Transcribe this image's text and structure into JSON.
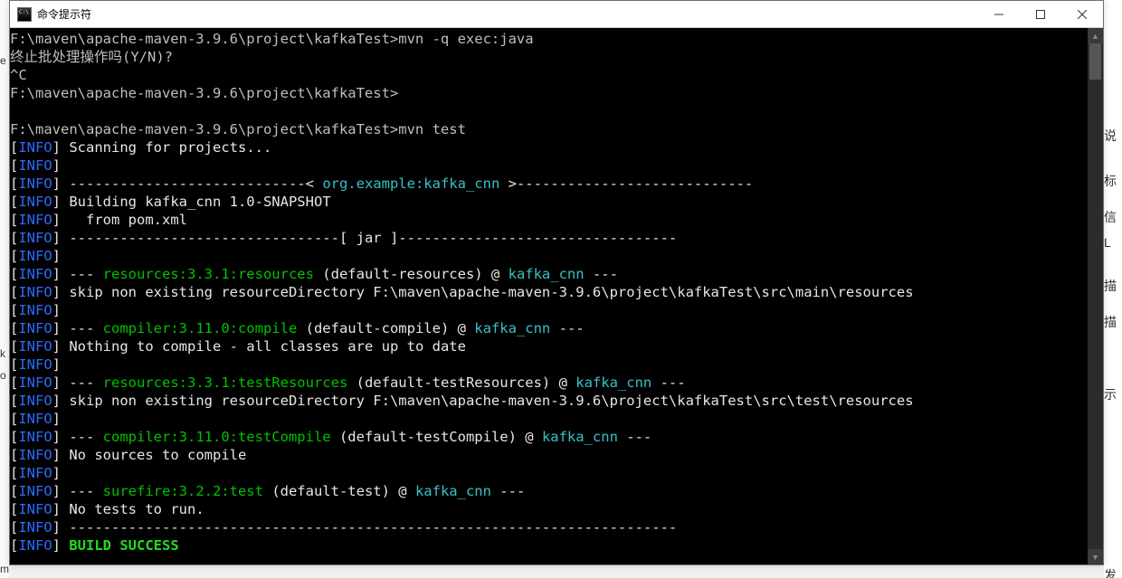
{
  "window": {
    "title": "命令提示符",
    "icon_name": "cmd-icon"
  },
  "prompt_path": "F:\\maven\\apache-maven-3.9.6\\project\\kafkaTest>",
  "lines": {
    "cmd1": "mvn -q exec:java",
    "l2": "终止批处理操作吗(Y/N)?",
    "l3": "^C",
    "cmd2_empty": "",
    "l_blank_path": "F:\\maven\\apache-maven-3.9.6\\project\\kafkaTest>",
    "cmd2": "mvn test",
    "scan": "Scanning for projects...",
    "rule1_pre": "----------------------------< ",
    "proj_id": "org.example:kafka_cnn",
    "rule1_post": " >----------------------------",
    "building": "Building kafka_cnn 1.0-SNAPSHOT",
    "from_pom": "  from pom.xml",
    "rule_jar": "--------------------------------[ jar ]---------------------------------",
    "goal_res": "resources:3.3.1:resources",
    "goal_res_rest_a": " (default-resources) @ ",
    "goal_res_rest_b": " ---",
    "skip_main": "skip non existing resourceDirectory F:\\maven\\apache-maven-3.9.6\\project\\kafkaTest\\src\\main\\resources",
    "goal_compile": "compiler:3.11.0:compile",
    "compile_rest_a": " (default-compile) @ ",
    "nothing_compile": "Nothing to compile - all classes are up to date",
    "goal_testres": "resources:3.3.1:testResources",
    "testres_rest_a": " (default-testResources) @ ",
    "skip_test": "skip non existing resourceDirectory F:\\maven\\apache-maven-3.9.6\\project\\kafkaTest\\src\\test\\resources",
    "goal_testcompile": "compiler:3.11.0:testCompile",
    "testcompile_rest_a": " (default-testCompile) @ ",
    "no_sources": "No sources to compile",
    "goal_surefire": "surefire:3.2.2:test",
    "surefire_rest_a": " (default-test) @ ",
    "no_tests": "No tests to run.",
    "rule_long": "------------------------------------------------------------------------",
    "build_success": "BUILD SUCCESS",
    "artifact": "kafka_cnn",
    "dashdash": "--- ",
    "dashdash_end": " ---"
  },
  "tags": {
    "info": "INFO",
    "lb": "[",
    "rb": "] "
  },
  "bg_fragments": {
    "r1": "说",
    "r2": "标",
    "r3": "信",
    "r4": "L",
    "r5": "描",
    "r6": "描",
    "r7": "示",
    "r8": "发",
    "l1": "e",
    "l2": "k",
    "l3": "o",
    "l4": "m"
  }
}
